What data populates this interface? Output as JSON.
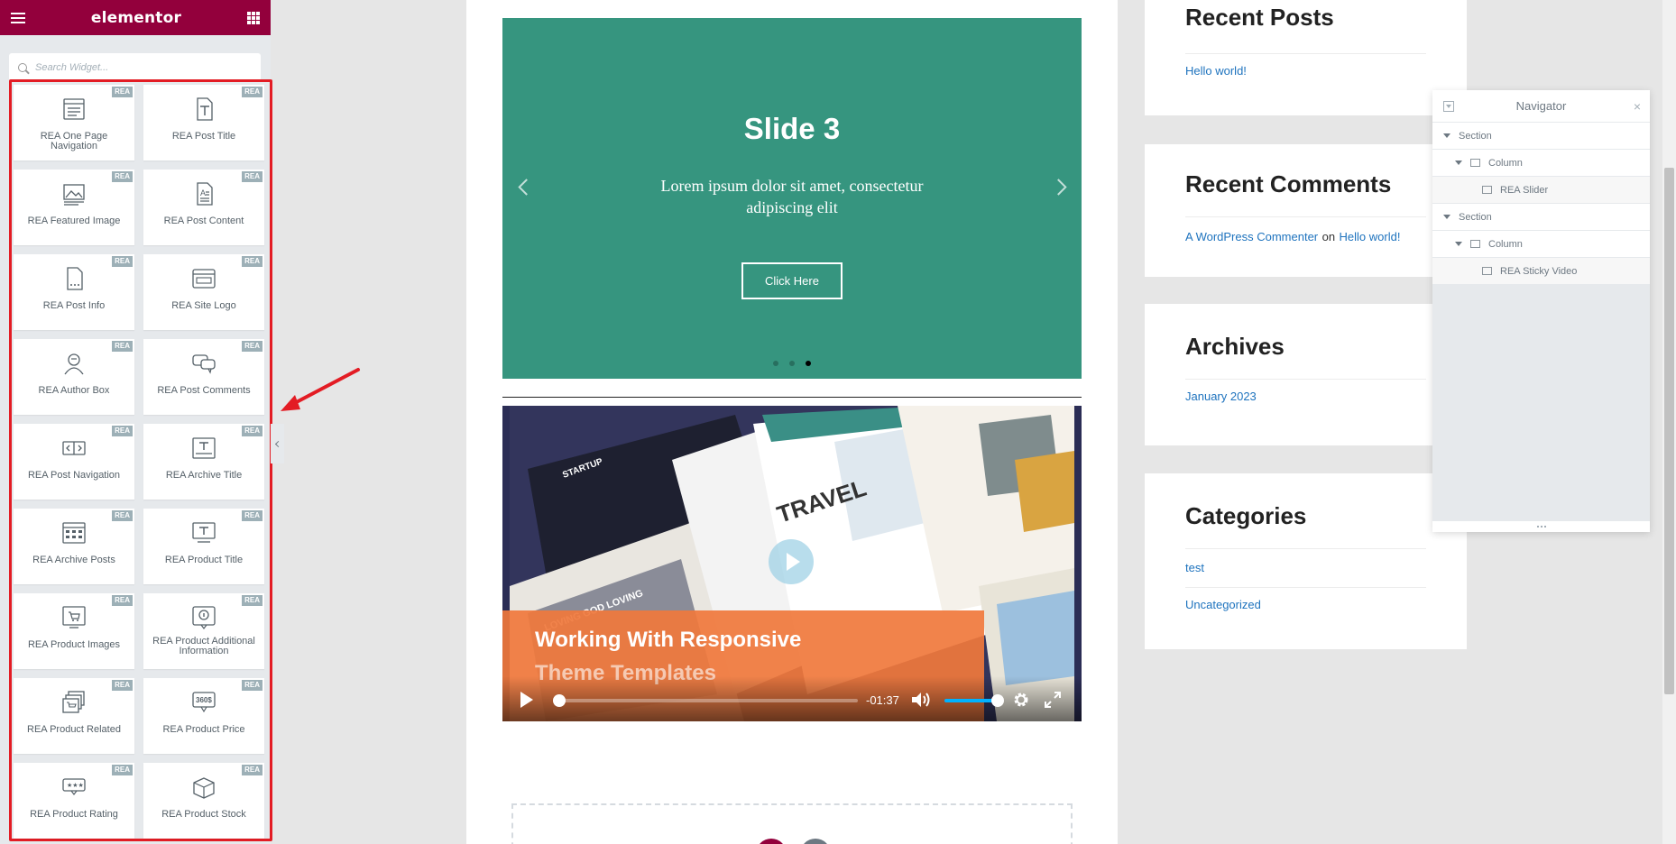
{
  "panel": {
    "brand": "elementor",
    "search_placeholder": "Search Widget...",
    "badge": "REA",
    "widgets": [
      {
        "label": "REA One Page Navigation",
        "icon": "one-page-nav-icon"
      },
      {
        "label": "REA Post Title",
        "icon": "post-title-icon"
      },
      {
        "label": "REA Featured Image",
        "icon": "featured-image-icon"
      },
      {
        "label": "REA Post Content",
        "icon": "post-content-icon"
      },
      {
        "label": "REA Post Info",
        "icon": "post-info-icon"
      },
      {
        "label": "REA Site Logo",
        "icon": "site-logo-icon"
      },
      {
        "label": "REA Author Box",
        "icon": "author-box-icon"
      },
      {
        "label": "REA Post Comments",
        "icon": "post-comments-icon"
      },
      {
        "label": "REA Post Navigation",
        "icon": "post-navigation-icon"
      },
      {
        "label": "REA Archive Title",
        "icon": "archive-title-icon"
      },
      {
        "label": "REA Archive Posts",
        "icon": "archive-posts-icon"
      },
      {
        "label": "REA Product Title",
        "icon": "product-title-icon"
      },
      {
        "label": "REA Product Images",
        "icon": "product-images-icon"
      },
      {
        "label": "REA Product Additional Information",
        "icon": "product-additional-info-icon"
      },
      {
        "label": "REA Product Related",
        "icon": "product-related-icon"
      },
      {
        "label": "REA Product Price",
        "icon": "product-price-icon"
      },
      {
        "label": "REA Product Rating",
        "icon": "product-rating-icon"
      },
      {
        "label": "REA Product Stock",
        "icon": "product-stock-icon"
      }
    ]
  },
  "slider": {
    "title": "Slide 3",
    "text": "Lorem ipsum dolor sit amet, consectetur adipiscing elit",
    "button": "Click Here",
    "slide_count": 3,
    "active_slide": 3,
    "bg_color": "#36957f"
  },
  "video": {
    "title_line1": "Working With Responsive",
    "title_line2": "Theme Templates",
    "time": "-01:37",
    "progress": 0,
    "volume": 1
  },
  "sidebar": {
    "recent_posts": {
      "title": "Recent Posts",
      "items": [
        "Hello world!"
      ]
    },
    "recent_comments": {
      "title": "Recent Comments",
      "author": "A WordPress Commenter",
      "on": "on",
      "post": "Hello world!"
    },
    "archives": {
      "title": "Archives",
      "items": [
        "January 2023"
      ]
    },
    "categories": {
      "title": "Categories",
      "items": [
        "test",
        "Uncategorized"
      ]
    }
  },
  "navigator": {
    "title": "Navigator",
    "close": "×",
    "items": [
      {
        "label": "Section",
        "level": 0,
        "caret": true,
        "icon": false
      },
      {
        "label": "Column",
        "level": 1,
        "caret": true,
        "icon": true
      },
      {
        "label": "REA Slider",
        "level": 2,
        "caret": false,
        "icon": true
      },
      {
        "label": "Section",
        "level": 0,
        "caret": true,
        "icon": false
      },
      {
        "label": "Column",
        "level": 1,
        "caret": true,
        "icon": true
      },
      {
        "label": "REA Sticky Video",
        "level": 2,
        "caret": false,
        "icon": true
      }
    ]
  },
  "colors": {
    "brand": "#93003c",
    "link": "#1e73be",
    "highlight": "#e31c24",
    "badge": "#9db0b7"
  }
}
